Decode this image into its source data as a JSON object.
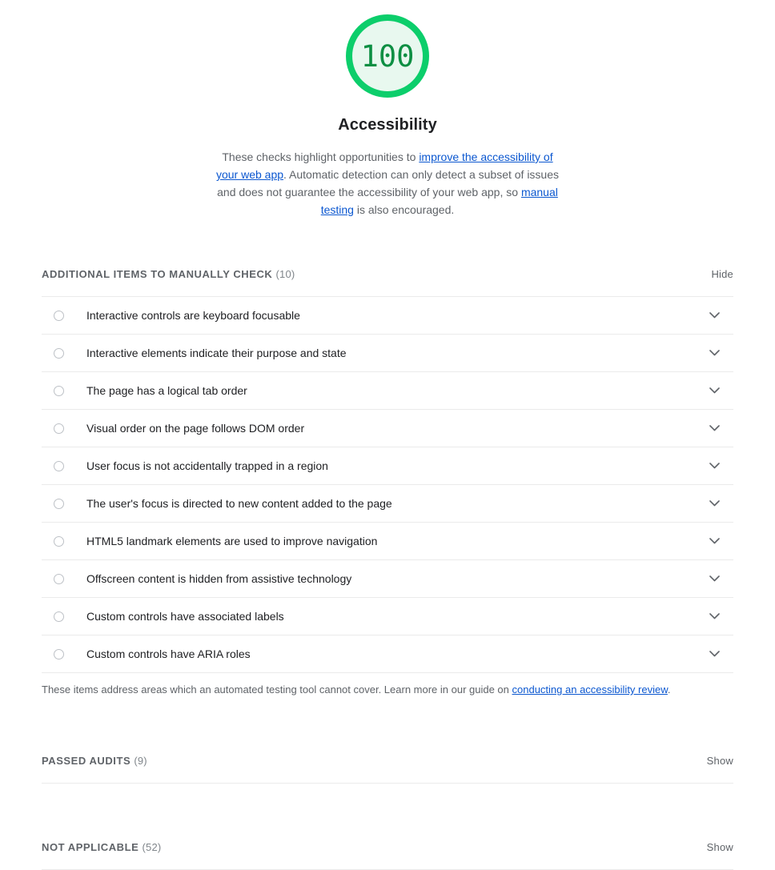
{
  "score": {
    "value": "100",
    "title": "Accessibility",
    "ring_color": "#0cce6b",
    "fill_color": "#e8f8ef",
    "value_color": "#0d8f43"
  },
  "description": {
    "part1": "These checks highlight opportunities to ",
    "link1": "improve the accessibility of your web app",
    "part2": ". Automatic detection can only detect a subset of issues and does not guarantee the accessibility of your web app, so ",
    "link2": "manual testing",
    "part3": " is also encouraged."
  },
  "manual_section": {
    "title": "ADDITIONAL ITEMS TO MANUALLY CHECK",
    "count": "(10)",
    "toggle": "Hide",
    "items": [
      {
        "label": "Interactive controls are keyboard focusable"
      },
      {
        "label": "Interactive elements indicate their purpose and state"
      },
      {
        "label": "The page has a logical tab order"
      },
      {
        "label": "Visual order on the page follows DOM order"
      },
      {
        "label": "User focus is not accidentally trapped in a region"
      },
      {
        "label": "The user's focus is directed to new content added to the page"
      },
      {
        "label": "HTML5 landmark elements are used to improve navigation"
      },
      {
        "label": "Offscreen content is hidden from assistive technology"
      },
      {
        "label": "Custom controls have associated labels"
      },
      {
        "label": "Custom controls have ARIA roles"
      }
    ],
    "footnote_part1": "These items address areas which an automated testing tool cannot cover. Learn more in our guide on ",
    "footnote_link": "conducting an accessibility review",
    "footnote_part2": "."
  },
  "passed_section": {
    "title": "PASSED AUDITS",
    "count": "(9)",
    "toggle": "Show"
  },
  "not_applicable_section": {
    "title": "NOT APPLICABLE",
    "count": "(52)",
    "toggle": "Show"
  },
  "colors": {
    "link": "#0b57d0",
    "text": "#202124",
    "muted": "#5f6368",
    "divider": "#ebebeb"
  }
}
